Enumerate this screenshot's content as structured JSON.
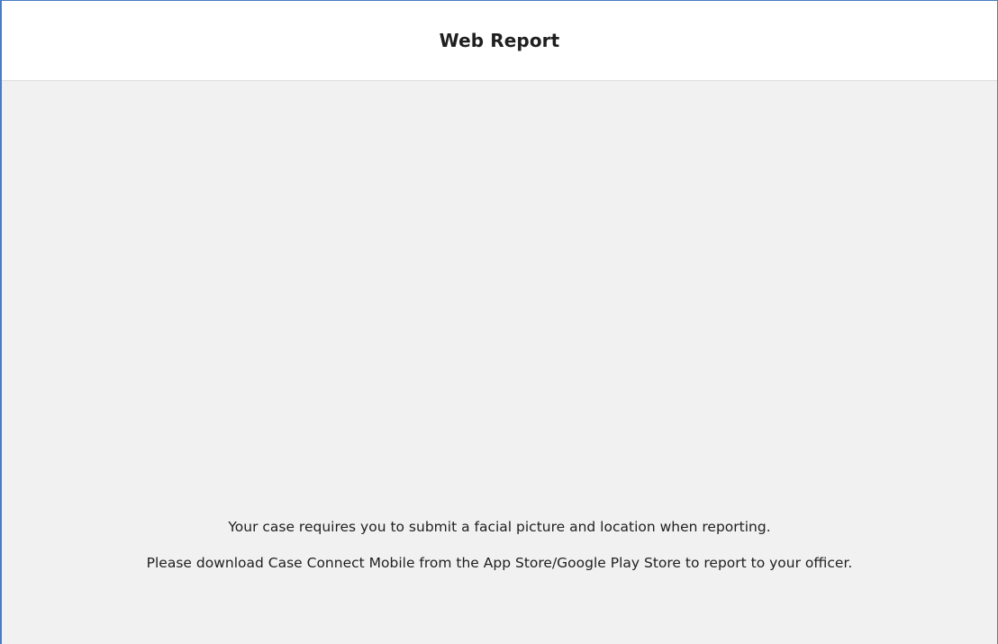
{
  "header": {
    "title": "Web Report"
  },
  "message": {
    "line1": "Your case requires you to submit a facial picture and location when reporting.",
    "line2": "Please download Case Connect Mobile from the App Store/Google Play Store to report to your officer."
  },
  "colors": {
    "frame_border": "#4a7cc4",
    "content_background": "#f1f1f1",
    "header_background": "#ffffff",
    "text": "#1f1f1f"
  }
}
